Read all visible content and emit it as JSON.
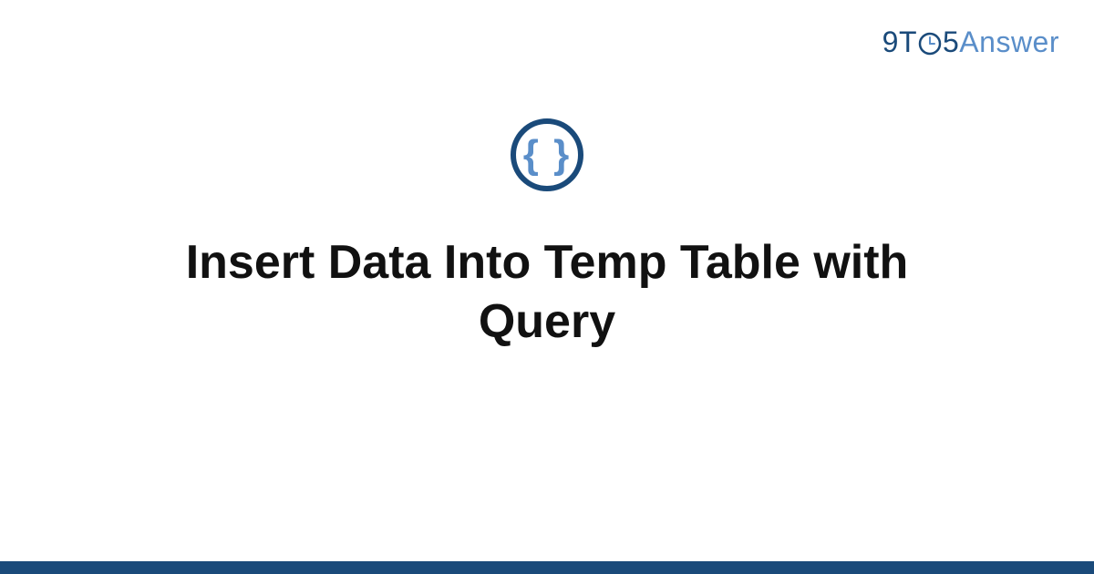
{
  "brand": {
    "part1": "9",
    "part2": "T",
    "part3": "5",
    "part4": "Answer"
  },
  "icon": {
    "symbol": "{ }"
  },
  "title": "Insert Data Into Temp Table with Query",
  "colors": {
    "dark_blue": "#1a4a7a",
    "light_blue": "#5a8ec9"
  }
}
